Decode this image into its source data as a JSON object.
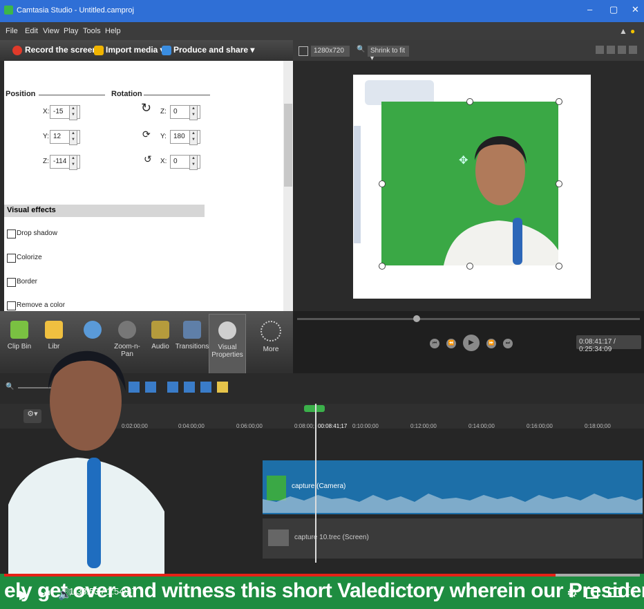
{
  "window": {
    "title": "Camtasia Studio - Untitled.camproj"
  },
  "menu": [
    "File",
    "Edit",
    "View",
    "Play",
    "Tools",
    "Help"
  ],
  "toolbar": {
    "record": "Record the screen ▾",
    "import": "Import media ▾",
    "produce": "Produce and share ▾"
  },
  "preview_toolbar": {
    "resolution": "1280x720",
    "zoom": "Shrink to fit ▾"
  },
  "properties": {
    "position_label": "Position",
    "rotation_label": "Rotation",
    "position": [
      {
        "axis": "X:",
        "value": "-15"
      },
      {
        "axis": "Y:",
        "value": "12"
      },
      {
        "axis": "Z:",
        "value": "-114"
      }
    ],
    "rotation": [
      {
        "axis": "Z:",
        "value": "0"
      },
      {
        "axis": "Y:",
        "value": "180"
      },
      {
        "axis": "X:",
        "value": "0"
      }
    ],
    "visual_effects_label": "Visual effects",
    "effects": [
      "Drop shadow",
      "Colorize",
      "Border",
      "Remove a color"
    ]
  },
  "tools": [
    "Clip Bin",
    "Libr",
    "",
    "Zoom-n-Pan",
    "Audio",
    "Transitions",
    "Visual Properties",
    "More"
  ],
  "playback": {
    "timecode": "0:08:41:17 / 0:25:34:09"
  },
  "ruler": {
    "ticks": [
      "0:02:00;00",
      "0:04:00;00",
      "0:06:00;00",
      "0:08:00;",
      "0:10:00;00",
      "0:12:00;00",
      "0:14:00;00",
      "0:16:00;00",
      "0:18:00;00"
    ],
    "playhead": "00:08:41;17"
  },
  "tracks": [
    {
      "label": "capture (Camera)"
    },
    {
      "label": "capture 10.trec (Screen)"
    }
  ],
  "youtube": {
    "time": "1:38:53 / 1:54:37",
    "subtitle": "ely get over and witness this short Valedictory wherein our President will be ad"
  },
  "colors": {
    "titlebar": "#2f6fd6",
    "green_screen": "#3aa845",
    "yt_progress": "#e62117",
    "track": "#1d6fa8"
  }
}
